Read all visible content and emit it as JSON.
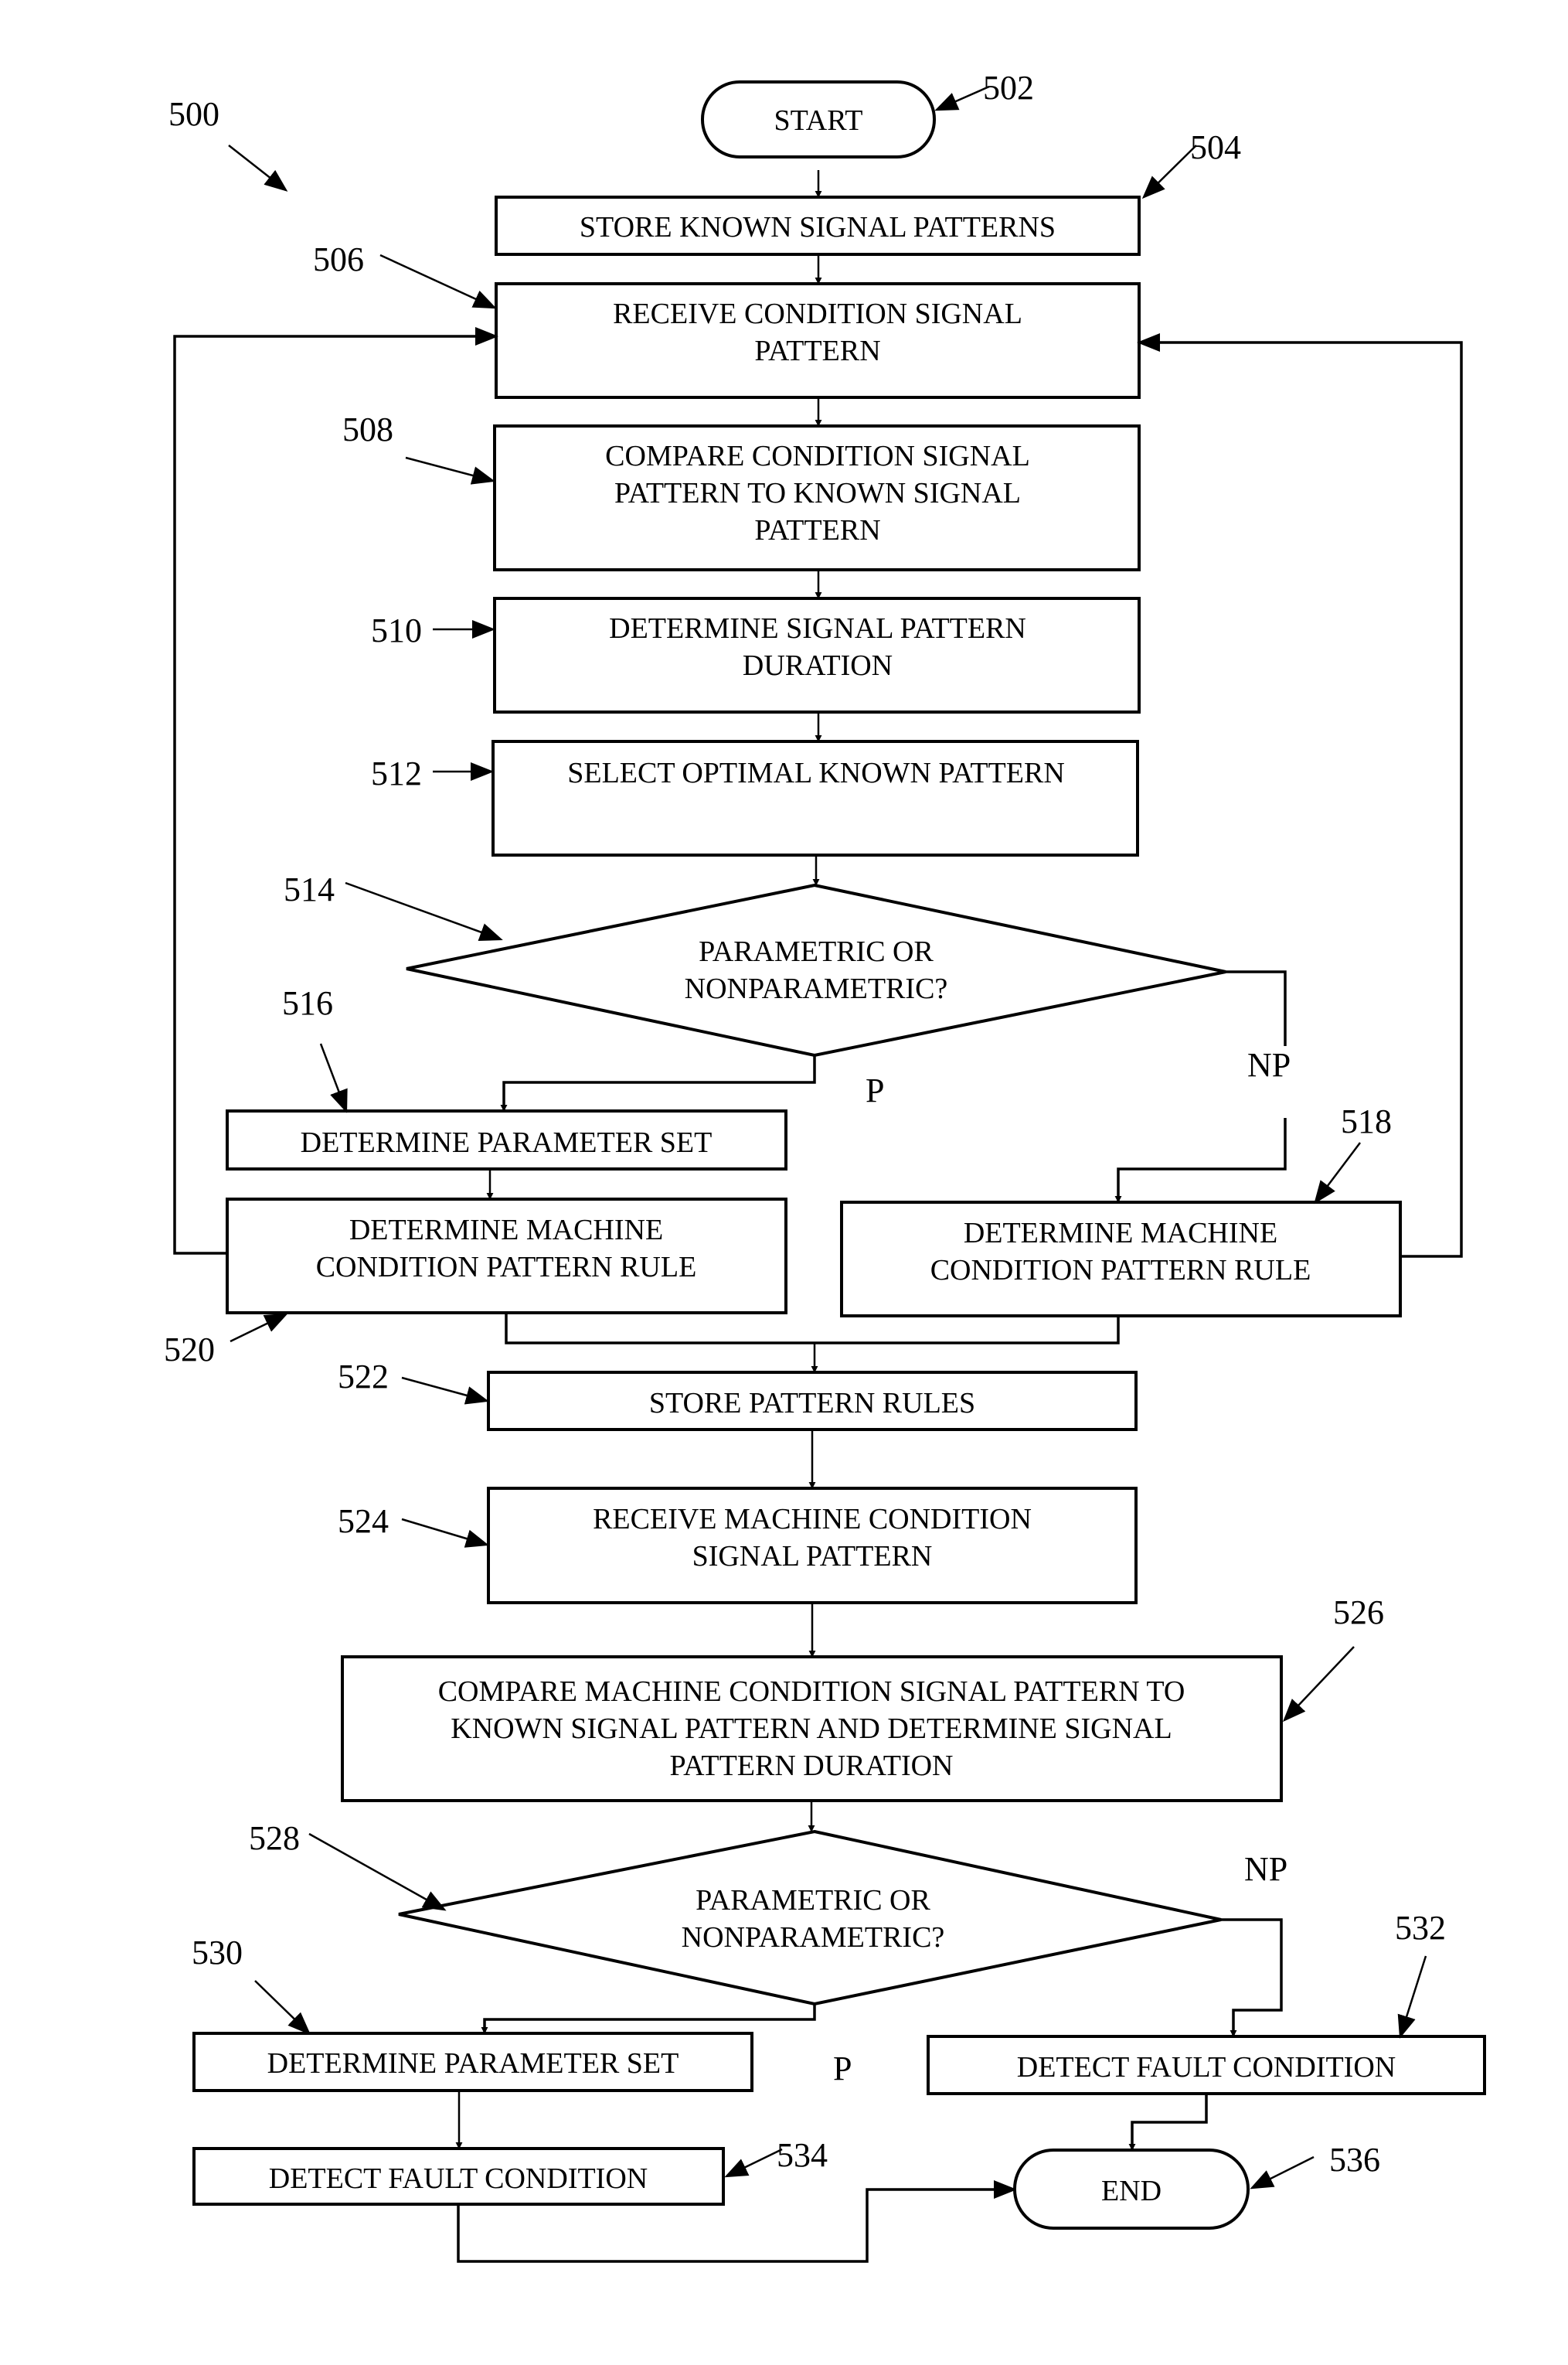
{
  "figure": {
    "reference": "500",
    "start": {
      "ref": "502",
      "label": "START"
    },
    "end": {
      "ref": "536",
      "label": "END"
    },
    "steps": [
      {
        "ref": "504",
        "lines": [
          "STORE KNOWN SIGNAL PATTERNS"
        ]
      },
      {
        "ref": "506",
        "lines": [
          "RECEIVE CONDITION SIGNAL",
          "PATTERN"
        ]
      },
      {
        "ref": "508",
        "lines": [
          "COMPARE CONDITION SIGNAL",
          "PATTERN TO KNOWN SIGNAL",
          "PATTERN"
        ]
      },
      {
        "ref": "510",
        "lines": [
          "DETERMINE SIGNAL PATTERN",
          "DURATION"
        ]
      },
      {
        "ref": "512",
        "lines": [
          "SELECT OPTIMAL KNOWN PATTERN"
        ]
      },
      {
        "ref": "514",
        "lines": [
          "PARAMETRIC OR",
          "NONPARAMETRIC?"
        ]
      },
      {
        "ref": "516",
        "lines": [
          "DETERMINE PARAMETER SET"
        ]
      },
      {
        "ref": "518",
        "lines": [
          "DETERMINE MACHINE",
          "CONDITION PATTERN RULE"
        ]
      },
      {
        "ref": "520",
        "lines": [
          "DETERMINE MACHINE",
          "CONDITION PATTERN RULE"
        ]
      },
      {
        "ref": "522",
        "lines": [
          "STORE PATTERN RULES"
        ]
      },
      {
        "ref": "524",
        "lines": [
          "RECEIVE MACHINE CONDITION",
          "SIGNAL PATTERN"
        ]
      },
      {
        "ref": "526",
        "lines": [
          "COMPARE MACHINE CONDITION SIGNAL PATTERN TO",
          "KNOWN SIGNAL PATTERN AND DETERMINE SIGNAL",
          "PATTERN DURATION"
        ]
      },
      {
        "ref": "528",
        "lines": [
          "PARAMETRIC OR",
          "NONPARAMETRIC?"
        ]
      },
      {
        "ref": "530",
        "lines": [
          "DETERMINE PARAMETER SET"
        ]
      },
      {
        "ref": "532",
        "lines": [
          "DETECT FAULT CONDITION"
        ]
      },
      {
        "ref": "534",
        "lines": [
          "DETECT FAULT CONDITION"
        ]
      }
    ],
    "branch_labels": {
      "d1_parametric": "P",
      "d1_nonparametric": "NP",
      "d2_parametric": "P",
      "d2_nonparametric": "NP"
    }
  }
}
